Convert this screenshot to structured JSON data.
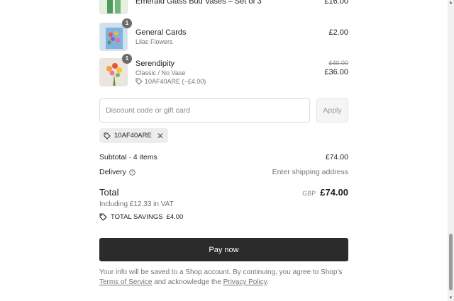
{
  "items": [
    {
      "name": "Emerald Glass Bud Vases – Set of 3",
      "price": "£16.00"
    },
    {
      "quantity": "1",
      "name": "General Cards",
      "variant": "Lilac Flowers",
      "price": "£2.00"
    },
    {
      "quantity": "1",
      "name": "Serendipity",
      "variant": "Classic / No Vase",
      "discount": "10AF40ARE (−£4.00)",
      "original_price": "£40.00",
      "price": "£36.00"
    }
  ],
  "discount_form": {
    "placeholder": "Discount code or gift card",
    "apply_label": "Apply"
  },
  "applied_code": "10AF40ARE",
  "summary": {
    "subtotal_label": "Subtotal · 4 items",
    "subtotal_value": "£74.00",
    "delivery_label": "Delivery",
    "delivery_value": "Enter shipping address",
    "total_label": "Total",
    "currency": "GBP",
    "total_value": "£74.00",
    "vat_note": "Including £12.33 in VAT",
    "savings_label": "TOTAL SAVINGS",
    "savings_value": "£4.00"
  },
  "pay_label": "Pay now",
  "legal": {
    "text_before": "Your info will be saved to a Shop account. By continuing, you agree to Shop’s",
    "terms_link": "Terms of Service",
    "text_middle": "and acknowledge the",
    "privacy_link": "Privacy Policy",
    "text_end": "."
  },
  "colors": {
    "pay_button": "#2b2b2b",
    "chip_bg": "#ededed",
    "badge": "#6b6b6b"
  }
}
